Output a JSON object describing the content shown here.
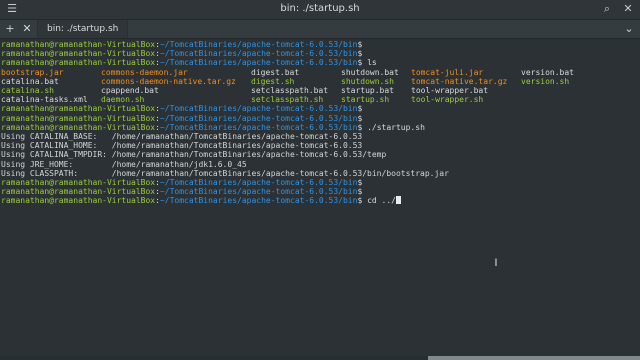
{
  "window": {
    "title": "bin: ./startup.sh",
    "buttons": {
      "hamburger_icon": "☰",
      "search_icon": "⌕",
      "close_icon": "✕"
    }
  },
  "tabs": {
    "new_tab_icon": "+",
    "close_tab_icon": "✕",
    "active_tab_label": "bin: ./startup.sh",
    "tab_dropdown_icon": "⌄"
  },
  "terminal": {
    "prompt_user": "ramanathan@ramanathan-VirtualBox",
    "prompt_path": "~/TomcatBinaries/apache-tomcat-6.0.53/bin",
    "prompt_sep": ":",
    "prompt_symbol": "$",
    "lines": [
      {
        "type": "prompt",
        "cmd": ""
      },
      {
        "type": "prompt",
        "cmd": ""
      },
      {
        "type": "prompt",
        "cmd": " ls"
      },
      {
        "type": "files",
        "cols": [
          {
            "t": "bootstrap.jar",
            "c": "o"
          },
          {
            "t": "commons-daemon.jar",
            "c": "o"
          },
          {
            "t": "digest.bat",
            "c": "w"
          },
          {
            "t": "shutdown.bat",
            "c": "w"
          },
          {
            "t": "tomcat-juli.jar",
            "c": "o"
          },
          {
            "t": "version.bat",
            "c": "w"
          }
        ]
      },
      {
        "type": "files",
        "cols": [
          {
            "t": "catalina.bat",
            "c": "w"
          },
          {
            "t": "commons-daemon-native.tar.gz",
            "c": "o"
          },
          {
            "t": "digest.sh",
            "c": "g"
          },
          {
            "t": "shutdown.sh",
            "c": "g"
          },
          {
            "t": "tomcat-native.tar.gz",
            "c": "o"
          },
          {
            "t": "version.sh",
            "c": "g"
          }
        ]
      },
      {
        "type": "files",
        "cols": [
          {
            "t": "catalina.sh",
            "c": "g"
          },
          {
            "t": "cpappend.bat",
            "c": "w"
          },
          {
            "t": "setclasspath.bat",
            "c": "w"
          },
          {
            "t": "startup.bat",
            "c": "w"
          },
          {
            "t": "tool-wrapper.bat",
            "c": "w"
          },
          {
            "t": "",
            "c": "w"
          }
        ]
      },
      {
        "type": "files",
        "cols": [
          {
            "t": "catalina-tasks.xml",
            "c": "w"
          },
          {
            "t": "daemon.sh",
            "c": "g"
          },
          {
            "t": "setclasspath.sh",
            "c": "g"
          },
          {
            "t": "startup.sh",
            "c": "g"
          },
          {
            "t": "tool-wrapper.sh",
            "c": "g"
          },
          {
            "t": "",
            "c": "w"
          }
        ]
      },
      {
        "type": "prompt",
        "cmd": ""
      },
      {
        "type": "prompt",
        "cmd": ""
      },
      {
        "type": "prompt",
        "cmd": " ./startup.sh"
      },
      {
        "type": "text",
        "text": "Using CATALINA_BASE:   /home/ramanathan/TomcatBinaries/apache-tomcat-6.0.53"
      },
      {
        "type": "text",
        "text": "Using CATALINA_HOME:   /home/ramanathan/TomcatBinaries/apache-tomcat-6.0.53"
      },
      {
        "type": "text",
        "text": "Using CATALINA_TMPDIR: /home/ramanathan/TomcatBinaries/apache-tomcat-6.0.53/temp"
      },
      {
        "type": "text",
        "text": "Using JRE_HOME:        /home/ramanathan/jdk1.6.0_45"
      },
      {
        "type": "text",
        "text": "Using CLASSPATH:       /home/ramanathan/TomcatBinaries/apache-tomcat-6.0.53/bin/bootstrap.jar"
      },
      {
        "type": "prompt",
        "cmd": ""
      },
      {
        "type": "prompt",
        "cmd": ""
      },
      {
        "type": "prompt",
        "cmd": " cd ../",
        "cursor": true
      }
    ]
  },
  "colors": {
    "background": "#2b3134",
    "prompt_user": "#9cce3b",
    "prompt_path": "#2f93e6",
    "archive": "#f38f1d",
    "executable": "#9cce3b",
    "text": "#d2d6d7"
  }
}
